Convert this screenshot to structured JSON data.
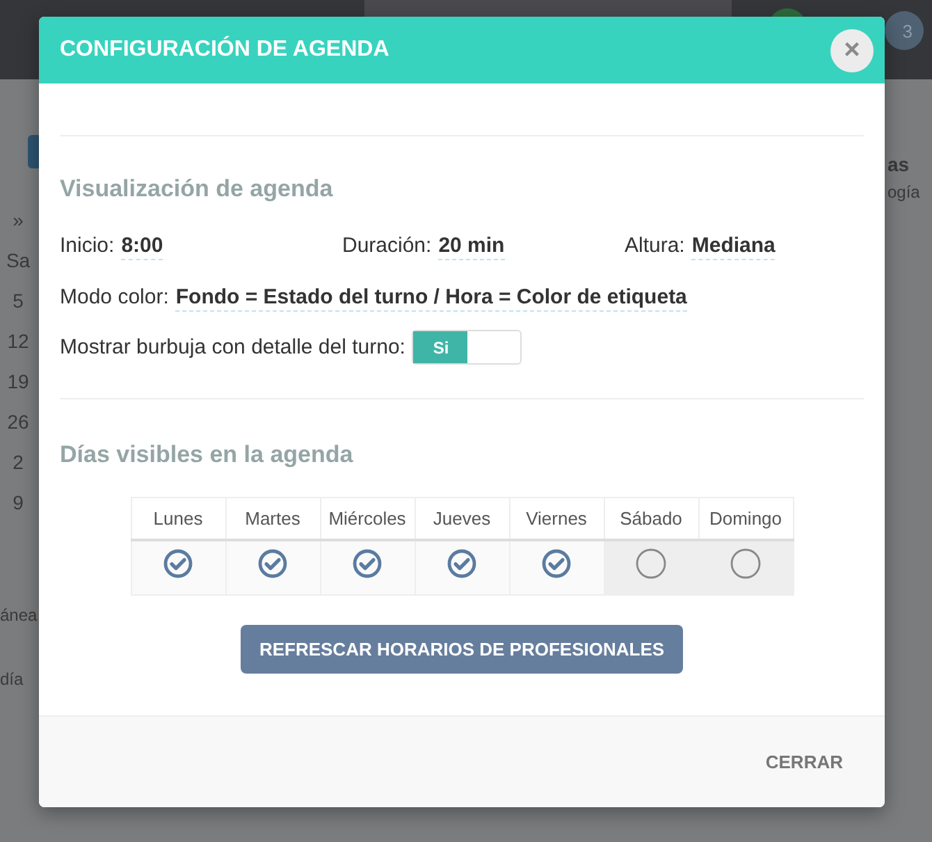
{
  "backdrop": {
    "badge": "3",
    "left_texts": [
      "»",
      "Sa",
      "5",
      "12",
      "19",
      "26",
      "2",
      "9"
    ],
    "left_lower_texts": [
      "ánea",
      "día"
    ],
    "right_texts": [
      "as",
      "ogía"
    ]
  },
  "modal": {
    "title": "CONFIGURACIÓN DE AGENDA",
    "close": "×",
    "display_section": {
      "heading": "Visualización de agenda",
      "settings": [
        {
          "label": "Inicio:",
          "value": "8:00"
        },
        {
          "label": "Duración:",
          "value": "20 min"
        },
        {
          "label": "Altura:",
          "value": "Mediana"
        }
      ],
      "color_mode": {
        "label": "Modo color:",
        "value": "Fondo = Estado del turno / Hora = Color de etiqueta"
      },
      "bubble": {
        "label": "Mostrar burbuja con detalle del turno:",
        "toggle_text": "Si",
        "on": true
      }
    },
    "days_section": {
      "heading": "Días visibles en la agenda",
      "days": [
        {
          "label": "Lunes",
          "checked": true
        },
        {
          "label": "Martes",
          "checked": true
        },
        {
          "label": "Miércoles",
          "checked": true
        },
        {
          "label": "Jueves",
          "checked": true
        },
        {
          "label": "Viernes",
          "checked": true
        },
        {
          "label": "Sábado",
          "checked": false
        },
        {
          "label": "Domingo",
          "checked": false
        }
      ]
    },
    "refresh_button": "REFRESCAR HORARIOS DE PROFESIONALES",
    "footer_button": "CERRAR"
  }
}
